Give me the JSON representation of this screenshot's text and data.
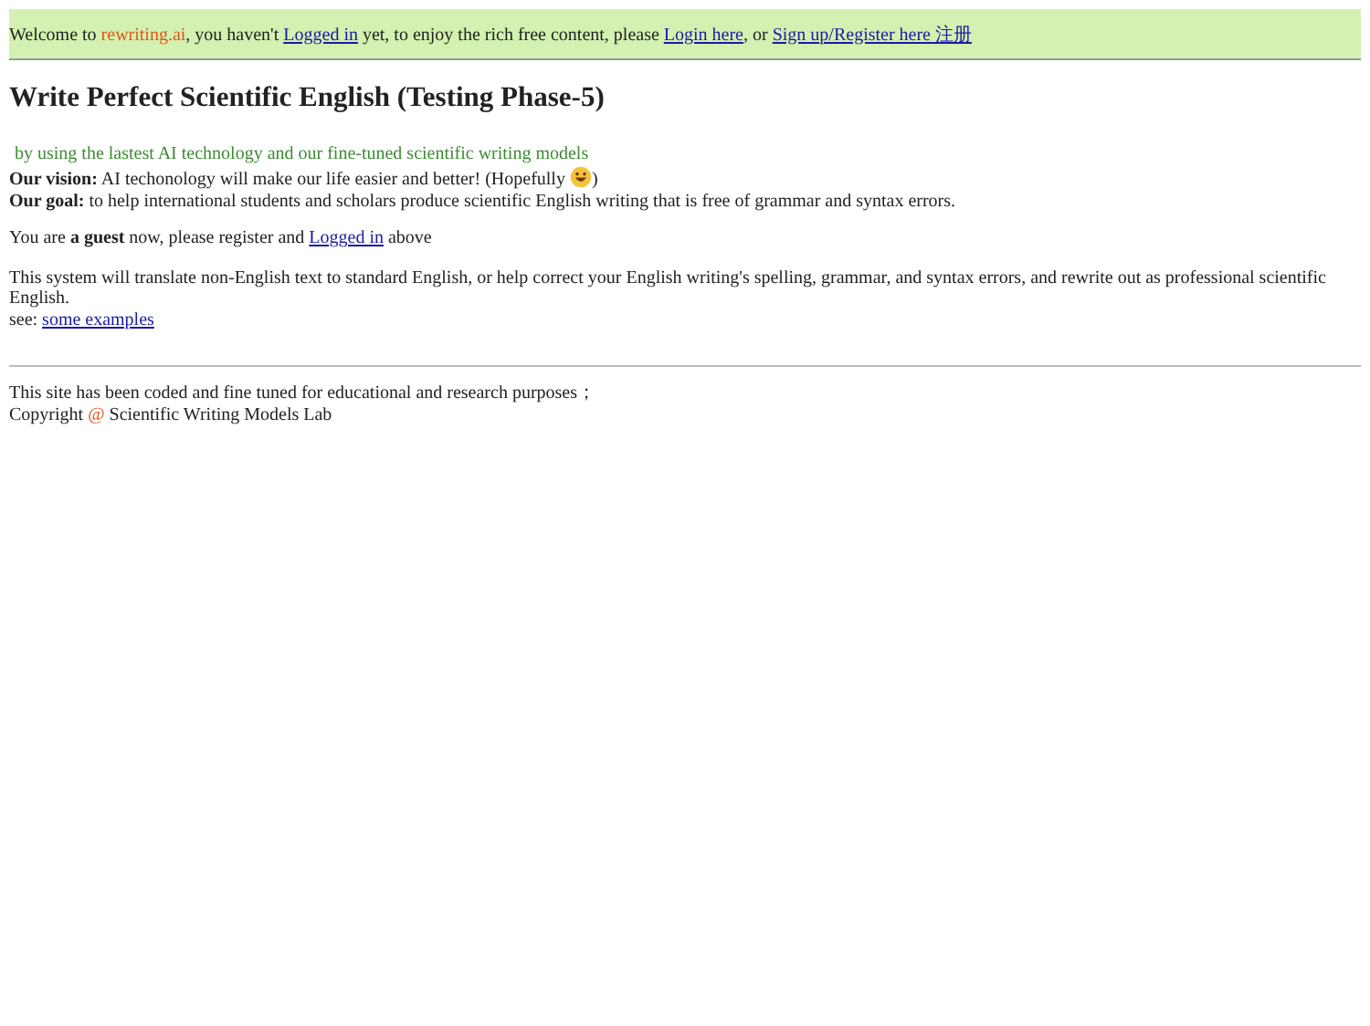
{
  "top_bar": [
    {
      "kind": "text",
      "text": "Welcome to "
    },
    {
      "kind": "brand",
      "text": "rewriting.ai"
    },
    {
      "kind": "text",
      "text": ", you haven't "
    },
    {
      "kind": "link",
      "text": "Logged in"
    },
    {
      "kind": "text",
      "text": " yet, to enjoy the rich free content, please "
    },
    {
      "kind": "link",
      "text": "Login here"
    },
    {
      "kind": "text",
      "text": ", or "
    },
    {
      "kind": "link",
      "text": "Sign up/Register here 注册"
    }
  ],
  "title": "Write Perfect Scientific English (Testing Phase-5)",
  "subtitle": "by using the lastest AI technology and our fine-tuned scientific writing models",
  "vision": {
    "label": "Our vision:",
    "text": " AI techonology will make our life easier and better! (Hopefully ",
    "after": ")"
  },
  "goal": {
    "label": "Our goal:",
    "text": " to help international students and scholars produce scientific English writing that is free of grammar and syntax errors."
  },
  "guest": [
    {
      "kind": "text",
      "text": "You are **a guest** now, please register and "
    },
    {
      "kind": "link",
      "text": "Logged in"
    },
    {
      "kind": "text",
      "text": " above"
    }
  ],
  "description": "This system will translate non-English text to standard English, or help correct your English writing's spelling, grammar, and syntax errors, and rewrite out as professional scientific English.",
  "see": [
    {
      "kind": "text",
      "text": "see: "
    },
    {
      "kind": "link",
      "text": "some examples"
    }
  ],
  "footer": {
    "note": "This site has been coded and fine tuned for educational and research purposes；",
    "copyright": [
      {
        "kind": "text",
        "text": "Copyright "
      },
      {
        "kind": "brand",
        "text": "@"
      },
      {
        "kind": "text",
        "text": " Scientific Writing Models Lab"
      }
    ]
  }
}
